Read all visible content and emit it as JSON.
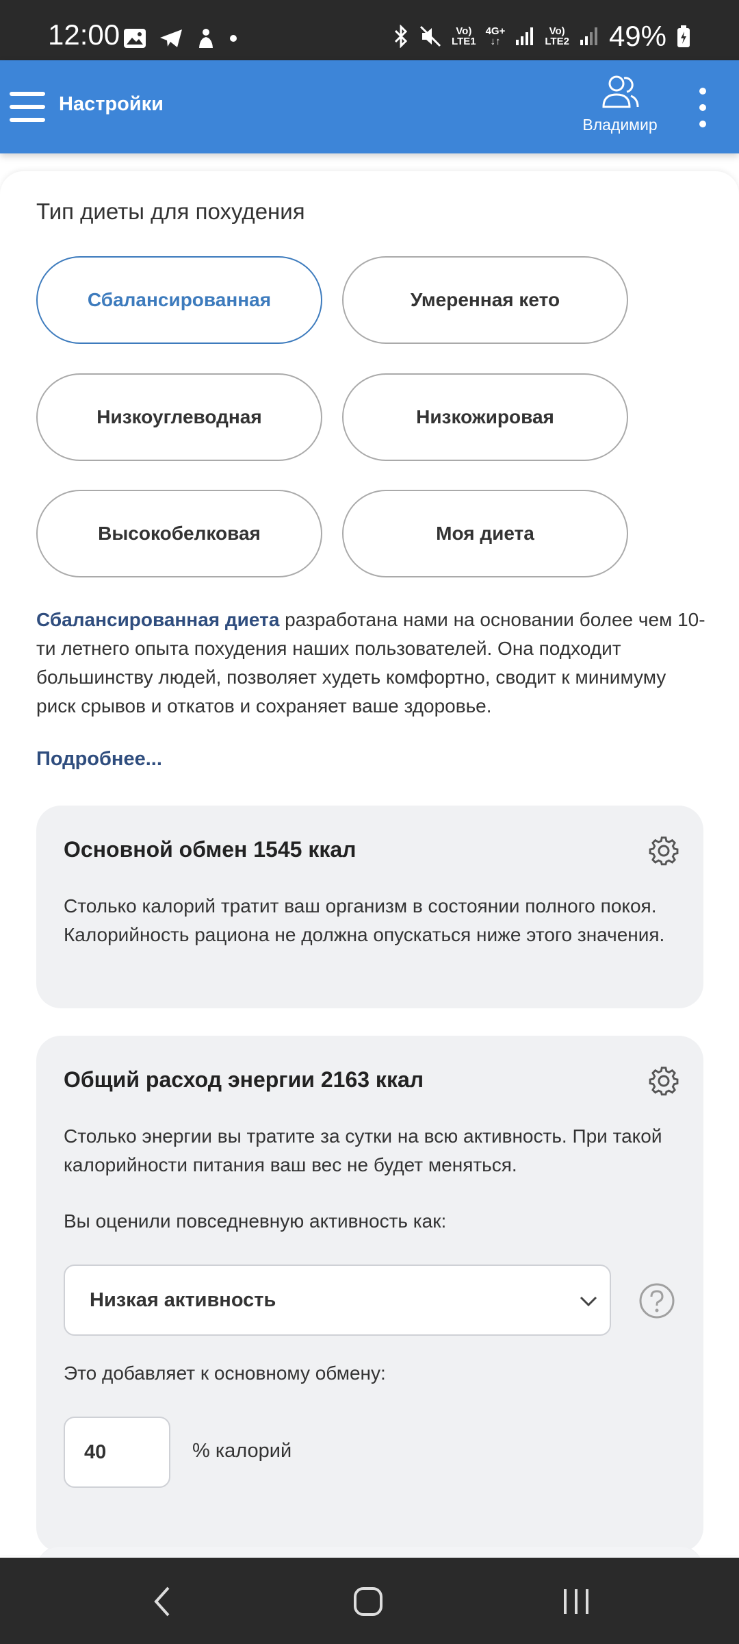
{
  "status_bar": {
    "time": "12:00",
    "battery": "49%",
    "sim1_top": "Vo)",
    "sim1_bottom": "LTE1",
    "network_top": "4G+",
    "sim2_top": "Vo)",
    "sim2_bottom": "LTE2",
    "icons": [
      "image-icon",
      "telegram-icon",
      "notification-icon",
      "dot-icon",
      "bluetooth-icon",
      "mute-icon",
      "signal-icon",
      "battery-icon"
    ]
  },
  "appbar": {
    "title": "Настройки",
    "user_name": "Владимир",
    "color": "#3d85d8"
  },
  "diet": {
    "section_title": "Тип диеты для похудения",
    "options": [
      {
        "label": "Сбалансированная",
        "selected": true
      },
      {
        "label": "Умеренная кето",
        "selected": false
      },
      {
        "label": "Низкоуглеводная",
        "selected": false
      },
      {
        "label": "Низкожировая",
        "selected": false
      },
      {
        "label": "Высокобелковая",
        "selected": false
      },
      {
        "label": "Моя диета",
        "selected": false
      }
    ],
    "description_highlight": "Сбалансированная диета",
    "description_rest": " разработана нами на основании более чем 10-ти летнего опыта похудения наших пользователей. Она подходит большинству людей, позволяет худеть комфортно, сводит к минимуму риск срывов и откатов и сохраняет ваше здоровье.",
    "more_link": "Подробнее..."
  },
  "bmr_card": {
    "title": "Основной обмен 1545 ккал",
    "text": "Столько калорий тратит ваш организм в состоянии полного покоя. Калорийность рациона не должна опускаться ниже этого значения."
  },
  "tdee_card": {
    "title": "Общий расход энергии 2163 ккал",
    "text": "Столько энергии вы тратите за сутки на всю активность. При такой калорийности питания ваш вес не будет меняться.",
    "activity_label": "Вы оценили повседневную активность как:",
    "activity_value": "Низкая активность",
    "adds_label": "Это добавляет к основному обмену:",
    "percent_value": "40",
    "percent_suffix": "% калорий"
  },
  "colors": {
    "accent": "#3d7bbd",
    "link": "#2f4d7e",
    "card_bg": "#f0f1f3",
    "status_bar": "#2a2a2a"
  }
}
